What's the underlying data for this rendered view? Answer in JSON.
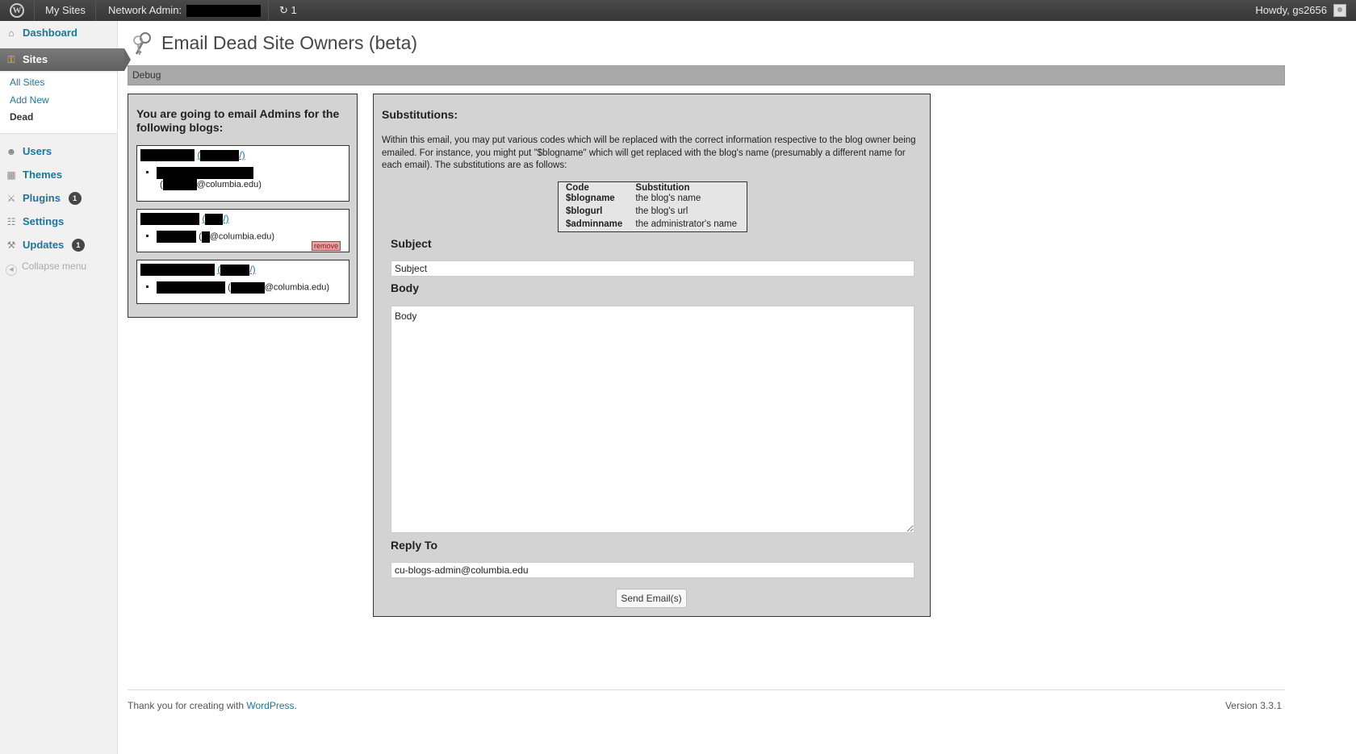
{
  "adminbar": {
    "my_sites": "My Sites",
    "network_admin": "Network Admin:",
    "updates_count": "1",
    "howdy": "Howdy, gs2656"
  },
  "sidebar": {
    "dashboard": "Dashboard",
    "sites": "Sites",
    "sub": {
      "all_sites": "All Sites",
      "add_new": "Add New",
      "dead": "Dead"
    },
    "users": "Users",
    "themes": "Themes",
    "plugins": "Plugins",
    "plugins_count": "1",
    "settings": "Settings",
    "updates": "Updates",
    "updates_count": "1",
    "collapse": "Collapse menu"
  },
  "page": {
    "title": "Email Dead Site Owners (beta)",
    "debug": "Debug"
  },
  "left_panel": {
    "heading": "You are going to email Admins for the following blogs:",
    "blogs": [
      {
        "open_paren": "(",
        "close_paren": "/)",
        "email_domain": "@columbia.edu)"
      },
      {
        "open_paren": "(",
        "close_paren": "/)",
        "email_domain": "@columbia.edu)",
        "remove": "remove"
      },
      {
        "open_paren": "(",
        "close_paren": "/)",
        "email_domain": "@columbia.edu)"
      }
    ]
  },
  "right_panel": {
    "substitutions_heading": "Substitutions:",
    "intro": "Within this email, you may put various codes which will be replaced with the correct information respective to the blog owner being emailed. For instance, you might put \"$blogname\" which will get replaced with the blog's name (presumably a different name for each email). The substitutions are as follows:",
    "table": {
      "headers": [
        "Code",
        "Substitution"
      ],
      "rows": [
        [
          "$blogname",
          "the blog's name"
        ],
        [
          "$blogurl",
          "the blog's url"
        ],
        [
          "$adminname",
          "the administrator's name"
        ]
      ]
    },
    "subject_label": "Subject",
    "subject_value": "Subject",
    "body_label": "Body",
    "body_value": "Body",
    "reply_to_label": "Reply To",
    "reply_to_value": "cu-blogs-admin@columbia.edu",
    "send_button": "Send Email(s)"
  },
  "footer": {
    "thanks": "Thank you for creating with ",
    "wordpress": "WordPress",
    "period": ".",
    "version": "Version 3.3.1"
  }
}
